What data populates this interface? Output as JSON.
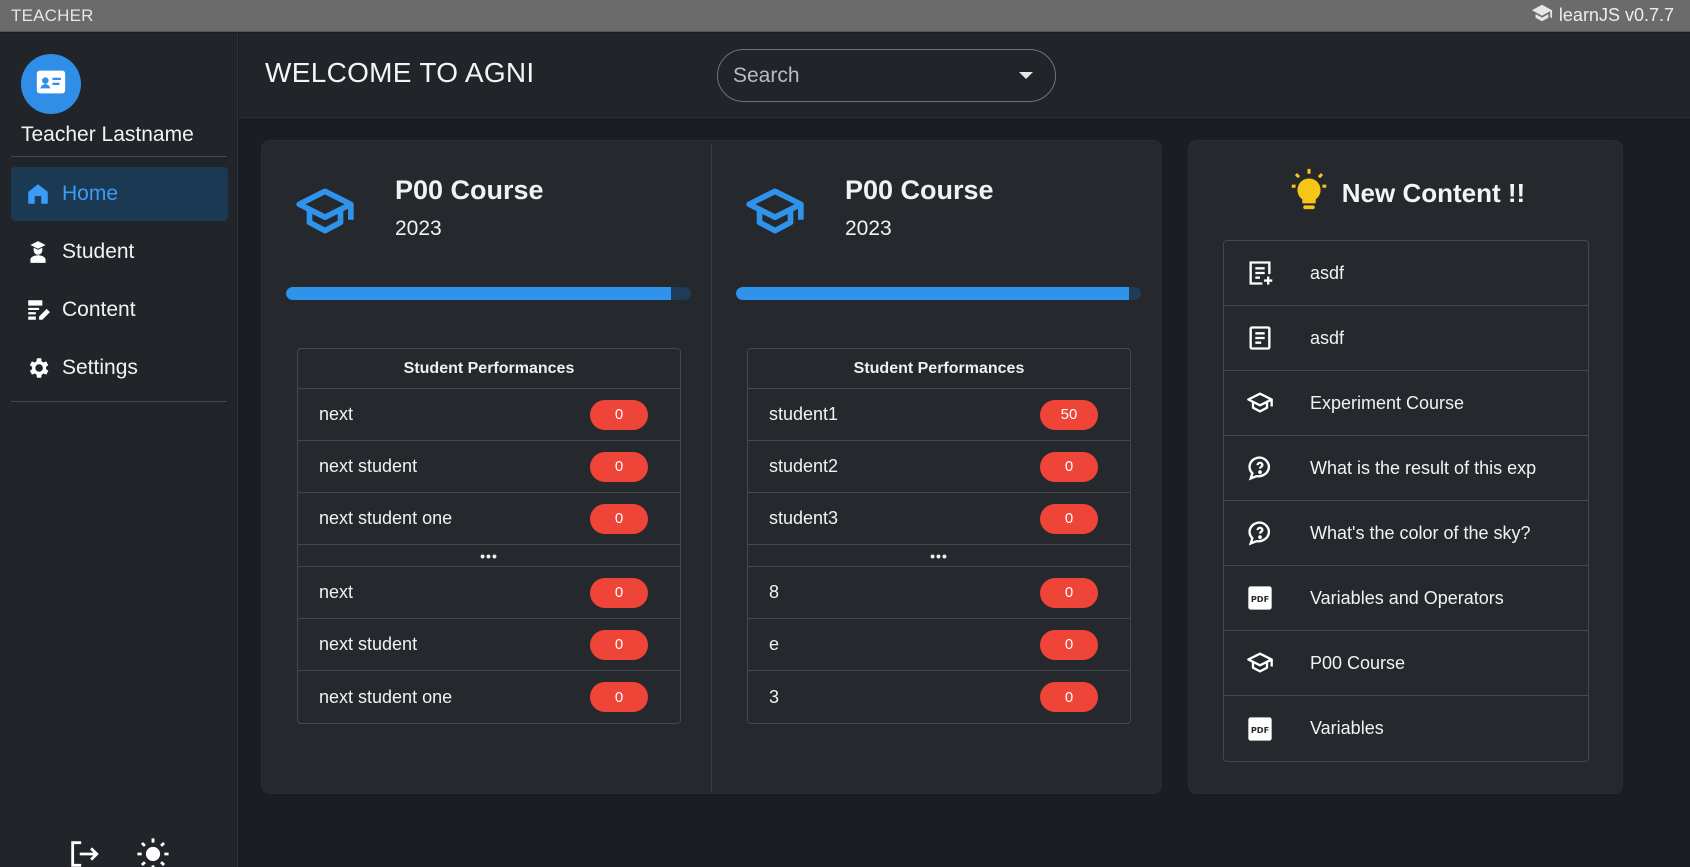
{
  "titlebar": {
    "role": "TEACHER",
    "app_name": "learnJS v0.7.7",
    "app_icon": "graduation-cap-icon"
  },
  "sidebar": {
    "username": "Teacher Lastname",
    "avatar_icon": "id-card-icon",
    "items": [
      {
        "label": "Home",
        "icon": "home-icon",
        "active": true
      },
      {
        "label": "Student",
        "icon": "student-icon",
        "active": false
      },
      {
        "label": "Content",
        "icon": "edit-note-icon",
        "active": false
      },
      {
        "label": "Settings",
        "icon": "gear-icon",
        "active": false
      }
    ],
    "bottom": {
      "logout_icon": "logout-icon",
      "theme_icon": "sun-icon"
    }
  },
  "header": {
    "welcome": "WELCOME TO AGNI",
    "search_placeholder": "Search"
  },
  "courses": [
    {
      "title": "P00 Course",
      "year": "2023",
      "progress": 0.95,
      "table_title": "Student Performances",
      "top": [
        {
          "name": "next",
          "score": "0"
        },
        {
          "name": "next student",
          "score": "0"
        },
        {
          "name": "next student one",
          "score": "0"
        }
      ],
      "separator": "•••",
      "bottom": [
        {
          "name": "next",
          "score": "0"
        },
        {
          "name": "next student",
          "score": "0"
        },
        {
          "name": "next student one",
          "score": "0"
        }
      ]
    },
    {
      "title": "P00 Course",
      "year": "2023",
      "progress": 0.97,
      "table_title": "Student Performances",
      "top": [
        {
          "name": "student1",
          "score": "50"
        },
        {
          "name": "student2",
          "score": "0"
        },
        {
          "name": "student3",
          "score": "0"
        }
      ],
      "separator": "•••",
      "bottom": [
        {
          "name": "8",
          "score": "0"
        },
        {
          "name": "e",
          "score": "0"
        },
        {
          "name": "3",
          "score": "0"
        }
      ]
    }
  ],
  "new_content": {
    "title": "New Content !!",
    "icon": "lightbulb-icon",
    "items": [
      {
        "label": "asdf",
        "icon": "note-add-icon"
      },
      {
        "label": "asdf",
        "icon": "article-icon"
      },
      {
        "label": "Experiment Course",
        "icon": "school-icon"
      },
      {
        "label": "What is the result of this exp",
        "icon": "question-bubble-icon"
      },
      {
        "label": "What's the color of the sky?",
        "icon": "question-bubble-icon"
      },
      {
        "label": "Variables and Operators",
        "icon": "pdf-icon"
      },
      {
        "label": "P00 Course",
        "icon": "school-icon"
      },
      {
        "label": "Variables",
        "icon": "pdf-icon"
      }
    ]
  },
  "colors": {
    "accent": "#2f93ec",
    "badge": "#ef4438",
    "bulb": "#f5c518"
  }
}
